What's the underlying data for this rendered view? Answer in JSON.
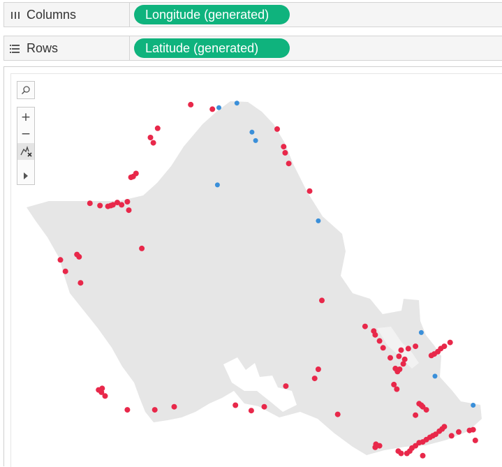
{
  "shelves": {
    "columns": {
      "label": "Columns",
      "pill": "Longitude (generated)"
    },
    "rows": {
      "label": "Rows",
      "pill": "Latitude (generated)"
    }
  },
  "map_toolbar": {
    "search_icon": "search-icon",
    "zoom_in": "+",
    "zoom_out": "−",
    "pan_icon": "pin-reset-icon",
    "expand_icon": "play-arrow-icon"
  },
  "colors": {
    "pill": "#0fb37d",
    "red_marks": "#e8284a",
    "blue_marks": "#3a8fd9",
    "land": "#e6e6e6"
  },
  "chart_data": {
    "type": "scatter",
    "title": "",
    "xlabel": "",
    "ylabel": "",
    "series": [
      {
        "color": "#e8284a",
        "points": [
          [
            -158.052,
            21.711
          ],
          [
            -158.022,
            21.705
          ],
          [
            -158.098,
            21.68
          ],
          [
            -158.108,
            21.668
          ],
          [
            -158.104,
            21.661
          ],
          [
            -158.128,
            21.621
          ],
          [
            -158.132,
            21.617
          ],
          [
            -158.135,
            21.616
          ],
          [
            -158.192,
            21.582
          ],
          [
            -158.178,
            21.579
          ],
          [
            -158.167,
            21.578
          ],
          [
            -158.163,
            21.579
          ],
          [
            -158.16,
            21.58
          ],
          [
            -158.154,
            21.583
          ],
          [
            -158.148,
            21.58
          ],
          [
            -158.14,
            21.584
          ],
          [
            -158.138,
            21.573
          ],
          [
            -158.233,
            21.508
          ],
          [
            -158.21,
            21.515
          ],
          [
            -158.207,
            21.512
          ],
          [
            -158.226,
            21.493
          ],
          [
            -158.205,
            21.478
          ],
          [
            -158.12,
            21.523
          ],
          [
            -157.932,
            21.679
          ],
          [
            -157.923,
            21.656
          ],
          [
            -157.921,
            21.648
          ],
          [
            -157.916,
            21.634
          ],
          [
            -157.887,
            21.598
          ],
          [
            -157.87,
            21.455
          ],
          [
            -157.81,
            21.421
          ],
          [
            -157.798,
            21.415
          ],
          [
            -157.796,
            21.41
          ],
          [
            -157.79,
            21.402
          ],
          [
            -157.785,
            21.393
          ],
          [
            -157.775,
            21.38
          ],
          [
            -157.768,
            21.366
          ],
          [
            -157.765,
            21.362
          ],
          [
            -157.77,
            21.345
          ],
          [
            -157.766,
            21.339
          ],
          [
            -157.74,
            21.395
          ],
          [
            -157.75,
            21.392
          ],
          [
            -157.76,
            21.39
          ],
          [
            -157.763,
            21.382
          ],
          [
            -157.755,
            21.378
          ],
          [
            -157.757,
            21.372
          ],
          [
            -157.762,
            21.365
          ],
          [
            -157.735,
            21.32
          ],
          [
            -157.732,
            21.318
          ],
          [
            -157.73,
            21.316
          ],
          [
            -157.725,
            21.312
          ],
          [
            -157.74,
            21.305
          ],
          [
            -157.7,
            21.29
          ],
          [
            -157.703,
            21.287
          ],
          [
            -157.707,
            21.284
          ],
          [
            -157.712,
            21.28
          ],
          [
            -157.716,
            21.278
          ],
          [
            -157.72,
            21.276
          ],
          [
            -157.725,
            21.273
          ],
          [
            -157.73,
            21.27
          ],
          [
            -157.735,
            21.269
          ],
          [
            -157.74,
            21.265
          ],
          [
            -157.745,
            21.262
          ],
          [
            -157.748,
            21.258
          ],
          [
            -157.752,
            21.255
          ],
          [
            -157.76,
            21.255
          ],
          [
            -157.764,
            21.258
          ],
          [
            -157.73,
            21.252
          ],
          [
            -157.69,
            21.278
          ],
          [
            -157.68,
            21.283
          ],
          [
            -157.665,
            21.285
          ],
          [
            -157.66,
            21.286
          ],
          [
            -157.657,
            21.272
          ],
          [
            -157.875,
            21.365
          ],
          [
            -157.88,
            21.353
          ],
          [
            -157.92,
            21.343
          ],
          [
            -157.95,
            21.316
          ],
          [
            -157.968,
            21.311
          ],
          [
            -157.99,
            21.318
          ],
          [
            -158.075,
            21.316
          ],
          [
            -158.102,
            21.312
          ],
          [
            -158.175,
            21.34
          ],
          [
            -158.18,
            21.338
          ],
          [
            -158.176,
            21.335
          ],
          [
            -158.171,
            21.33
          ],
          [
            -158.14,
            21.312
          ],
          [
            -157.848,
            21.306
          ],
          [
            -157.79,
            21.265
          ],
          [
            -157.796,
            21.263
          ],
          [
            -157.795,
            21.267
          ],
          [
            -157.692,
            21.4
          ],
          [
            -157.7,
            21.395
          ],
          [
            -157.705,
            21.392
          ],
          [
            -157.709,
            21.388
          ],
          [
            -157.714,
            21.385
          ],
          [
            -157.718,
            21.383
          ]
        ]
      },
      {
        "color": "#3a8fd9",
        "points": [
          [
            -158.013,
            21.707
          ],
          [
            -157.988,
            21.713
          ],
          [
            -157.967,
            21.675
          ],
          [
            -157.962,
            21.664
          ],
          [
            -158.015,
            21.606
          ],
          [
            -157.875,
            21.559
          ],
          [
            -157.732,
            21.413
          ],
          [
            -157.713,
            21.356
          ],
          [
            -157.66,
            21.318
          ]
        ]
      }
    ]
  }
}
